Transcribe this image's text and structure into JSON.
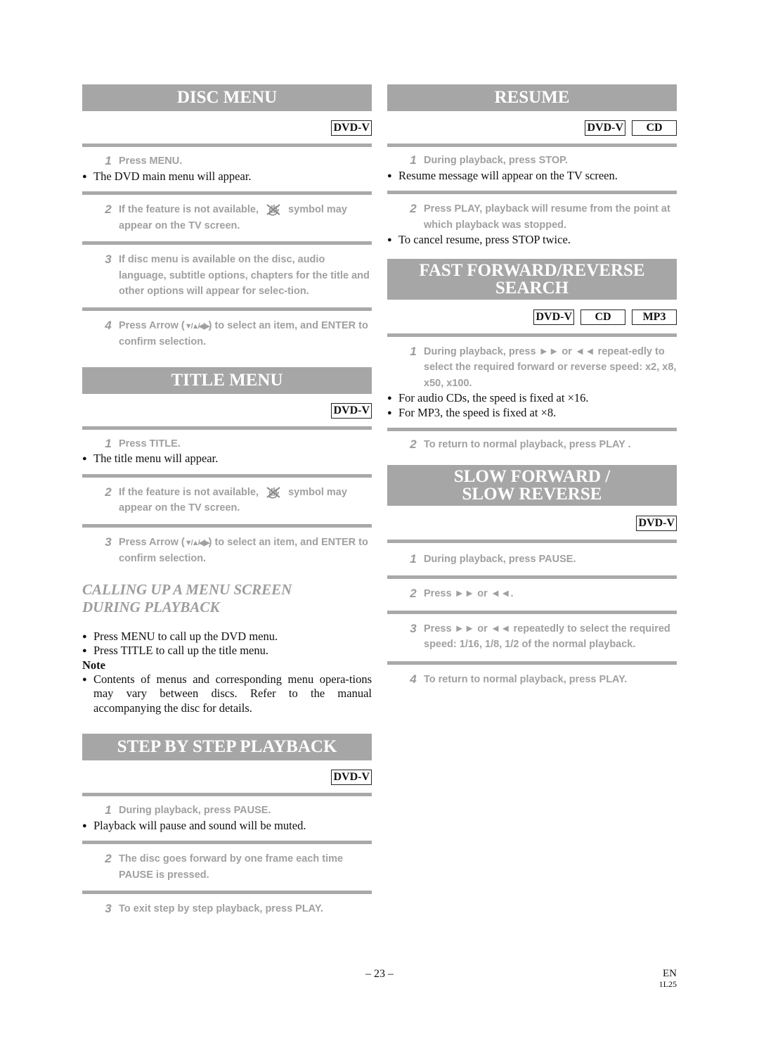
{
  "left_column": {
    "disc_menu": {
      "title": "DISC MENU",
      "badges": [
        "DVD-V"
      ],
      "step1": {
        "num": "1",
        "text": "Press MENU."
      },
      "step1_bullet": "The DVD main menu will appear.",
      "step2": {
        "num": "2",
        "text_before": "If the feature is not available,",
        "text_after": "symbol may appear on the TV screen."
      },
      "step3": {
        "num": "3",
        "text": "If disc menu is available on the disc, audio language, subtitle options, chapters for the title and other options will appear for selec-tion."
      },
      "step4": {
        "num": "4",
        "text_before": "Press Arrow (",
        "arrows": "▼/▲/◀/▶",
        "text_after": ") to select an item, and ENTER to confirm selection."
      }
    },
    "title_menu": {
      "title": "TITLE MENU",
      "badges": [
        "DVD-V"
      ],
      "step1": {
        "num": "1",
        "text": "Press TITLE."
      },
      "step1_bullet": "The title menu will appear.",
      "step2": {
        "num": "2",
        "text_before": "If the feature is not available,",
        "text_after": "symbol may appear on the TV screen."
      },
      "step3": {
        "num": "3",
        "text_before": "Press Arrow (",
        "arrows": "▼/▲/◀/▶",
        "text_after": ") to select an item, and ENTER to confirm selection."
      }
    },
    "calling_up": {
      "heading_line1": "CALLING UP A MENU SCREEN",
      "heading_line2": "DURING PLAYBACK",
      "bullets": [
        "Press MENU to call up the DVD menu.",
        "Press TITLE to call up the title menu."
      ],
      "note_label": "Note",
      "note_bullet": "Contents of menus and corresponding menu opera-tions may vary between discs. Refer to the manual accompanying the disc for details."
    },
    "step_by_step": {
      "title": "STEP BY STEP PLAYBACK",
      "badges": [
        "DVD-V"
      ],
      "step1": {
        "num": "1",
        "text": "During playback, press PAUSE."
      },
      "step1_bullet": "Playback will pause and sound will be muted.",
      "step2": {
        "num": "2",
        "text": "The disc goes forward by one frame each time PAUSE is pressed."
      },
      "step3": {
        "num": "3",
        "text": "To exit step by step playback, press PLAY."
      }
    }
  },
  "right_column": {
    "resume": {
      "title": "RESUME",
      "badges": [
        "DVD-V",
        "CD"
      ],
      "step1": {
        "num": "1",
        "text": "During playback, press STOP."
      },
      "step1_bullet": "Resume message will appear on the TV screen.",
      "step2": {
        "num": "2",
        "text": "Press PLAY, playback will resume from the point at which playback was stopped."
      },
      "step2_bullet": "To cancel resume, press STOP twice."
    },
    "fast_forward": {
      "title_line1": "FAST FORWARD/REVERSE",
      "title_line2": "SEARCH",
      "badges": [
        "DVD-V",
        "CD",
        "MP3"
      ],
      "step1": {
        "num": "1",
        "text_before": "During playback, press",
        "ff": "►►",
        "or": "or",
        "rew": "◄◄",
        "text_after": "repeat-edly to select the required forward or reverse speed: x2, x8, x50, x100."
      },
      "bullets": [
        "For audio CDs, the speed is fixed at ×16.",
        "For MP3, the speed is fixed at ×8."
      ],
      "step2": {
        "num": "2",
        "text": "To return to normal playback, press PLAY ."
      }
    },
    "slow": {
      "title_line1": "SLOW FORWARD /",
      "title_line2": "SLOW REVERSE",
      "badges": [
        "DVD-V"
      ],
      "step1": {
        "num": "1",
        "text": "During playback, press PAUSE."
      },
      "step2": {
        "num": "2",
        "text_before": "Press",
        "ff": "►►",
        "or": "or",
        "rew": "◄◄",
        "text_after": "."
      },
      "step3": {
        "num": "3",
        "text_before": "Press",
        "ff": "►►",
        "or": "or",
        "rew": "◄◄",
        "text_after": "repeatedly to select the required speed: 1/16, 1/8, 1/2 of the normal playback."
      },
      "step4": {
        "num": "4",
        "text": "To return to normal playback, press PLAY."
      }
    }
  },
  "footer": {
    "page_number": "– 23 –",
    "language": "EN",
    "code": "1L25"
  },
  "icons": {
    "prohibited_hand": "prohibited-hand-icon"
  }
}
